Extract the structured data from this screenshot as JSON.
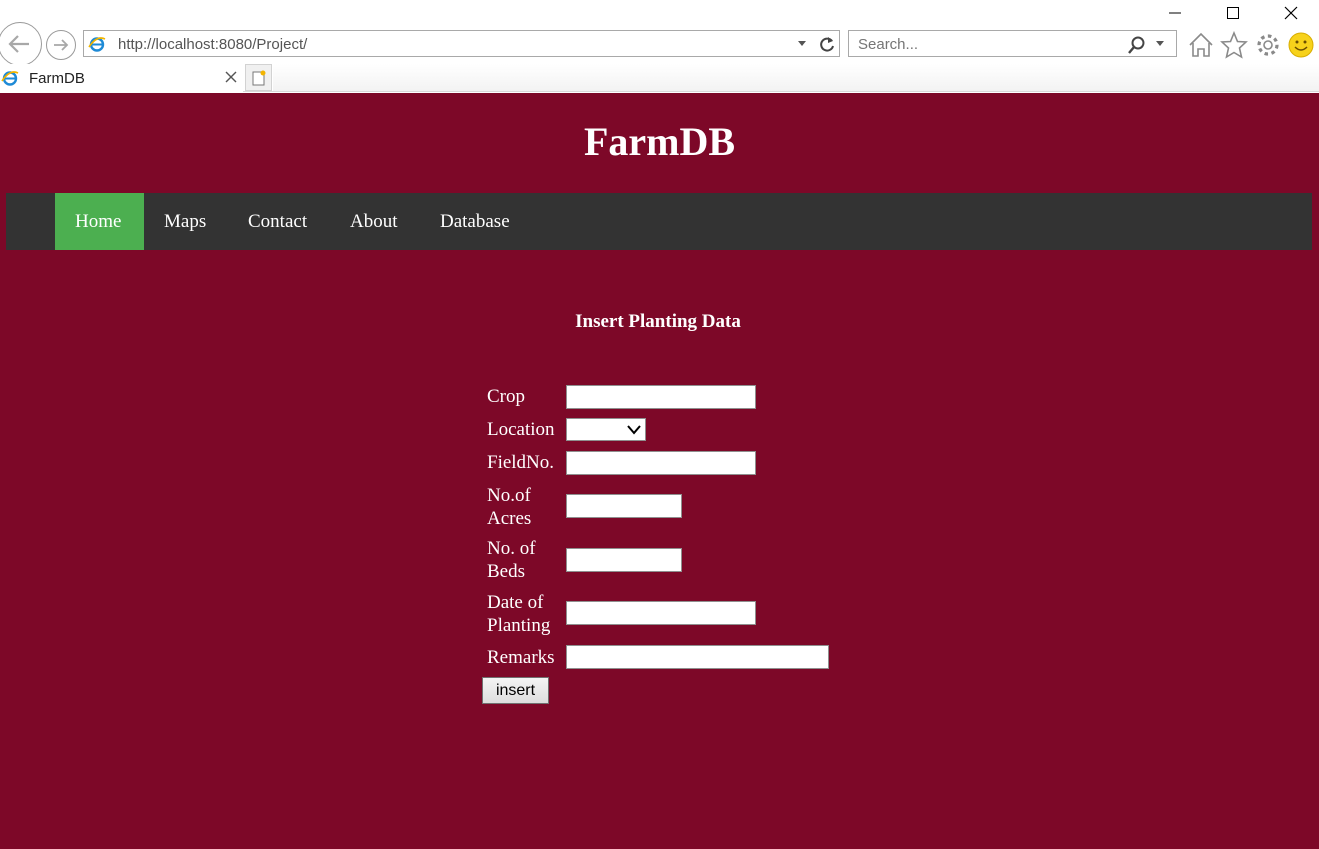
{
  "browser": {
    "address": "http://localhost:8080/Project/",
    "search_placeholder": "Search...",
    "tab_title": "FarmDB"
  },
  "site": {
    "title": "FarmDB"
  },
  "nav": {
    "items": [
      {
        "label": "Home",
        "active": true
      },
      {
        "label": "Maps"
      },
      {
        "label": "Contact"
      },
      {
        "label": "About"
      },
      {
        "label": "Database"
      }
    ],
    "active_color": "#4caf50",
    "bar_color": "#333333"
  },
  "form": {
    "title": "Insert Planting Data",
    "crop": {
      "label": "Crop",
      "value": ""
    },
    "location": {
      "label": "Location",
      "value": ""
    },
    "field_no": {
      "label": "FieldNo.",
      "value": ""
    },
    "acres": {
      "label_line1": "No.of",
      "label_line2": "Acres",
      "value": ""
    },
    "beds": {
      "label_line1": "No. of",
      "label_line2": "Beds",
      "value": ""
    },
    "date": {
      "label_line1": "Date of",
      "label_line2": "Planting",
      "value": ""
    },
    "remarks": {
      "label": "Remarks",
      "value": ""
    },
    "submit_label": "insert"
  },
  "colors": {
    "page_background": "#7d0828",
    "text": "#ffffff"
  },
  "icons": {
    "back": "back-arrow-icon",
    "forward": "forward-arrow-icon",
    "refresh": "refresh-icon",
    "search": "search-icon",
    "home": "home-icon",
    "favorites": "star-icon",
    "settings": "gear-icon",
    "feedback": "smiley-icon"
  }
}
